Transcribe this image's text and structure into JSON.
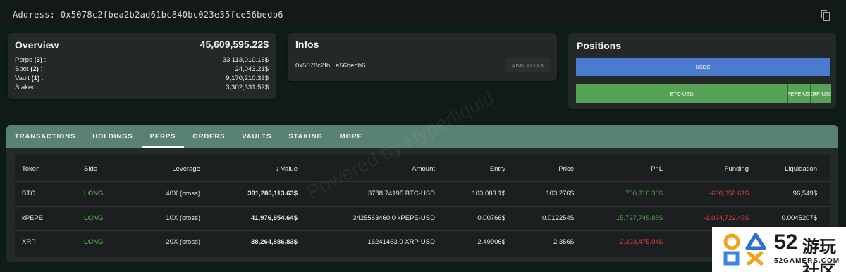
{
  "address_bar": {
    "text": "Address: 0x5078c2fbea2b2ad61bc840bc023e35fce56bedb6"
  },
  "overview": {
    "title": "Overview",
    "total": "45,609,595.22$",
    "rows": [
      {
        "label": "Perps ",
        "count": "(3)",
        "suffix": " :",
        "value": "33,113,010.16$"
      },
      {
        "label": "Spot ",
        "count": "(2)",
        "suffix": " :",
        "value": "24,043.21$"
      },
      {
        "label": "Vault ",
        "count": "(1)",
        "suffix": " :",
        "value": "9,170,210.33$"
      },
      {
        "label": "Staked :",
        "count": "",
        "suffix": "",
        "value": "3,302,331.52$"
      }
    ]
  },
  "infos": {
    "title": "Infos",
    "address_short": "0x5078c2fb...e56bedb6",
    "add_alias_label": "ADD ALIAS"
  },
  "positions": {
    "title": "Positions",
    "bars": [
      {
        "segments": [
          {
            "label": "USDC",
            "share": 0.995,
            "color": "#4a7bcc"
          }
        ]
      },
      {
        "segments": [
          {
            "label": "BTC-USD",
            "share": 0.829,
            "color": "#57a355"
          },
          {
            "label": "kPEPE-USD",
            "share": 0.089,
            "color": "#57a355"
          },
          {
            "label": "XRP-USD",
            "share": 0.082,
            "color": "#57a355"
          }
        ]
      }
    ]
  },
  "tabs": [
    "TRANSACTIONS",
    "HOLDINGS",
    "PERPS",
    "ORDERS",
    "VAULTS",
    "STAKING",
    "MORE"
  ],
  "active_tab": "PERPS",
  "table": {
    "columns": [
      "Token",
      "Side",
      "Leverage",
      "Value",
      "Amount",
      "Entry",
      "Price",
      "PnL",
      "Funding",
      "Liquidation"
    ],
    "sort_column": "Value",
    "rows": [
      {
        "token": "BTC",
        "side": "LONG",
        "leverage": "40X (cross)",
        "value": "391,286,113.63$",
        "amount": "3788.74195 BTC-USD",
        "entry": "103,083.1$",
        "price": "103,276$",
        "pnl": "730,716.36$",
        "funding": "-600,058.61$",
        "liquidation": "96,549$"
      },
      {
        "token": "kPEPE",
        "side": "LONG",
        "leverage": "10X (cross)",
        "value": "41,976,854.64$",
        "amount": "3425563460.0 kPEPE-USD",
        "entry": "0.00766$",
        "price": "0.012254$",
        "pnl": "15,727,745.88$",
        "funding": "-1,034,722.45$",
        "liquidation": "0.0045207$"
      },
      {
        "token": "XRP",
        "side": "LONG",
        "leverage": "20X (cross)",
        "value": "38,264,886.83$",
        "amount": "16241463.0 XRP-USD",
        "entry": "2.49906$",
        "price": "2.356$",
        "pnl": "-2,323,475.04$",
        "funding": "",
        "liquidation": ""
      }
    ]
  },
  "watermark": "Powered by Hyperliquid",
  "logo": {
    "number": "52",
    "chinese": "游玩社区",
    "site": "52GAMERS.COM"
  },
  "colors": {
    "positive": "#4ea54a",
    "negative": "#e0403f",
    "tab_bar": "#5a8272",
    "usdc_bar": "#4a7bcc",
    "perp_bar": "#57a355"
  }
}
